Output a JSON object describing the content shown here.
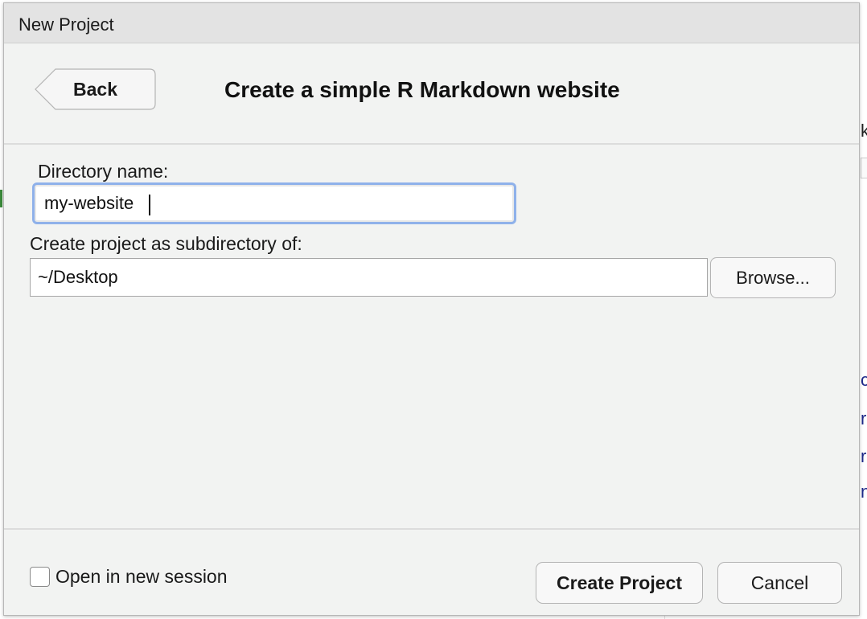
{
  "dialog": {
    "title": "New Project",
    "back_label": "Back",
    "heading": "Create a simple R Markdown website"
  },
  "form": {
    "directory_label": "Directory name:",
    "directory_value": "my-website",
    "subdir_label": "Create project as subdirectory of:",
    "subdir_value": "~/Desktop",
    "browse_label": "Browse..."
  },
  "footer": {
    "open_new_session_label": "Open in new session",
    "open_new_session_checked": false,
    "create_label": "Create Project",
    "cancel_label": "Cancel"
  },
  "background": {
    "fragments": [
      "k",
      "c",
      "r",
      "r",
      "n"
    ]
  },
  "colors": {
    "focus_ring": "#8fb1ea",
    "dialog_bg": "#f2f3f2",
    "titlebar_bg": "#e3e3e3"
  }
}
